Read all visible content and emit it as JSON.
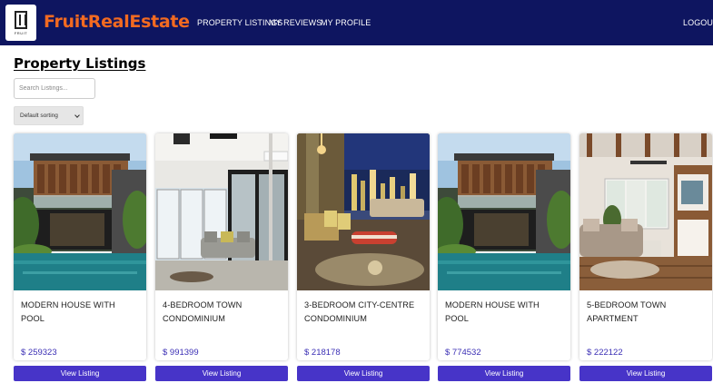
{
  "navbar": {
    "brand": "FruitRealEstate",
    "logo_text": "FRUIT",
    "links": [
      {
        "label": "PROPERTY LISTINGS"
      },
      {
        "label": "MY REVIEWS"
      },
      {
        "label": "MY PROFILE"
      }
    ],
    "logout_label": "LOGOUT"
  },
  "page": {
    "title": "Property Listings",
    "search_placeholder": "Search Listings...",
    "sort_value": "Default sorting"
  },
  "listings": [
    {
      "title": "MODERN HOUSE WITH POOL",
      "price": "$ 259323",
      "button": "View Listing",
      "image": "modern-house-pool"
    },
    {
      "title": "4-BEDROOM TOWN CONDOMINIUM",
      "price": "$ 991399",
      "button": "View Listing",
      "image": "condo-living-room"
    },
    {
      "title": "3-BEDROOM CITY-CENTRE CONDOMINIUM",
      "price": "$ 218178",
      "button": "View Listing",
      "image": "city-night-living-room"
    },
    {
      "title": "MODERN HOUSE WITH POOL",
      "price": "$ 774532",
      "button": "View Listing",
      "image": "modern-house-pool"
    },
    {
      "title": "5-BEDROOM TOWN APARTMENT",
      "price": "$ 222122",
      "button": "View Listing",
      "image": "wood-living-room"
    }
  ],
  "colors": {
    "navbar_bg": "#0e1560",
    "brand": "#f26a21",
    "button_bg": "#4734c8",
    "price": "#3b2fb5"
  }
}
